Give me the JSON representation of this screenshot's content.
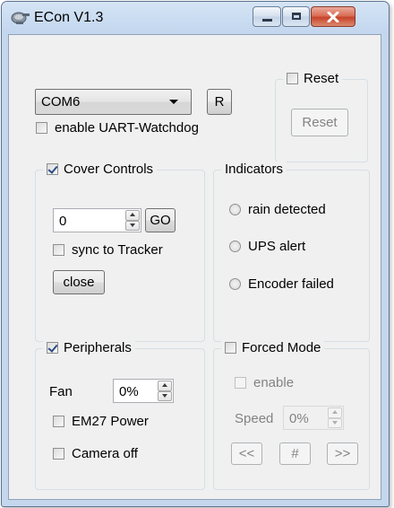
{
  "window": {
    "title": "ECon V1.3",
    "icon": "satellite-dish-icon",
    "controls": [
      "minimize-icon",
      "maximize-icon",
      "close-icon"
    ]
  },
  "connection": {
    "port_selected": "COM6",
    "refresh_label": "R",
    "watchdog_label": "enable UART-Watchdog",
    "watchdog_checked": false
  },
  "reset_group": {
    "checkbox_label": "Reset",
    "checked": false,
    "button_label": "Reset",
    "button_enabled": false
  },
  "cover_controls": {
    "label": "Cover Controls",
    "checked": true,
    "position_value": "0",
    "go_label": "GO",
    "sync_label": "sync to Tracker",
    "sync_checked": false,
    "close_label": "close"
  },
  "indicators": {
    "label": "Indicators",
    "items": [
      {
        "label": "rain detected"
      },
      {
        "label": "UPS alert"
      },
      {
        "label": "Encoder failed"
      }
    ]
  },
  "peripherals": {
    "label": "Peripherals",
    "checked": true,
    "fan_label": "Fan",
    "fan_value": "0%",
    "em27_label": "EM27 Power",
    "em27_checked": false,
    "camera_label": "Camera off",
    "camera_checked": false
  },
  "forced_mode": {
    "label": "Forced Mode",
    "checked": false,
    "enable_label": "enable",
    "enable_checked": false,
    "speed_label": "Speed",
    "speed_value": "0%",
    "buttons": [
      "<<",
      "#",
      ">>"
    ]
  },
  "colors": {
    "window_frame": "#c4d7ec",
    "client_bg": "#f0f0f0",
    "close_button": "#c7432a",
    "disabled_text": "#838383"
  }
}
